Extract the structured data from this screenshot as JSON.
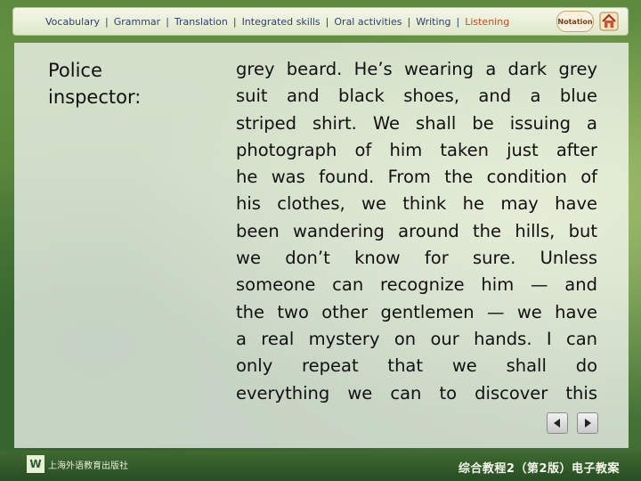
{
  "nav": {
    "items": [
      {
        "label": "Vocabulary"
      },
      {
        "label": "Grammar"
      },
      {
        "label": "Translation"
      },
      {
        "label": "Integrated skills"
      },
      {
        "label": "Oral activities"
      },
      {
        "label": "Writing"
      },
      {
        "label": "Listening"
      }
    ],
    "separator": "|",
    "notation_label": "Notation",
    "icons": [
      "notation-icon",
      "home-icon"
    ]
  },
  "slide": {
    "speaker": "Police inspector:",
    "passage_lines": [
      "grey beard. He’s wearing a dark grey",
      "suit and black shoes, and a blue",
      "striped shirt. We shall be issuing a",
      "photograph of him taken just after",
      "he was found. From the condition of",
      "his clothes, we think he may have",
      "been wandering around the hills, but",
      "we don’t know for sure. Unless",
      "someone can recognize him — and",
      "the two other gentlemen — we have",
      "a real mystery on our hands. I can",
      "only repeat that we shall do",
      "everything we can to discover this"
    ]
  },
  "controls": {
    "prev_icon": "triangle-left-icon",
    "next_icon": "triangle-right-icon"
  },
  "footer": {
    "publisher": "上海外语教育出版社",
    "course_title": "综合教程2（第2版）电子教案"
  },
  "colors": {
    "nav_text": "#2f3f6a",
    "nav_active": "#c9472a",
    "footer_bg": "#2f5a2a"
  }
}
